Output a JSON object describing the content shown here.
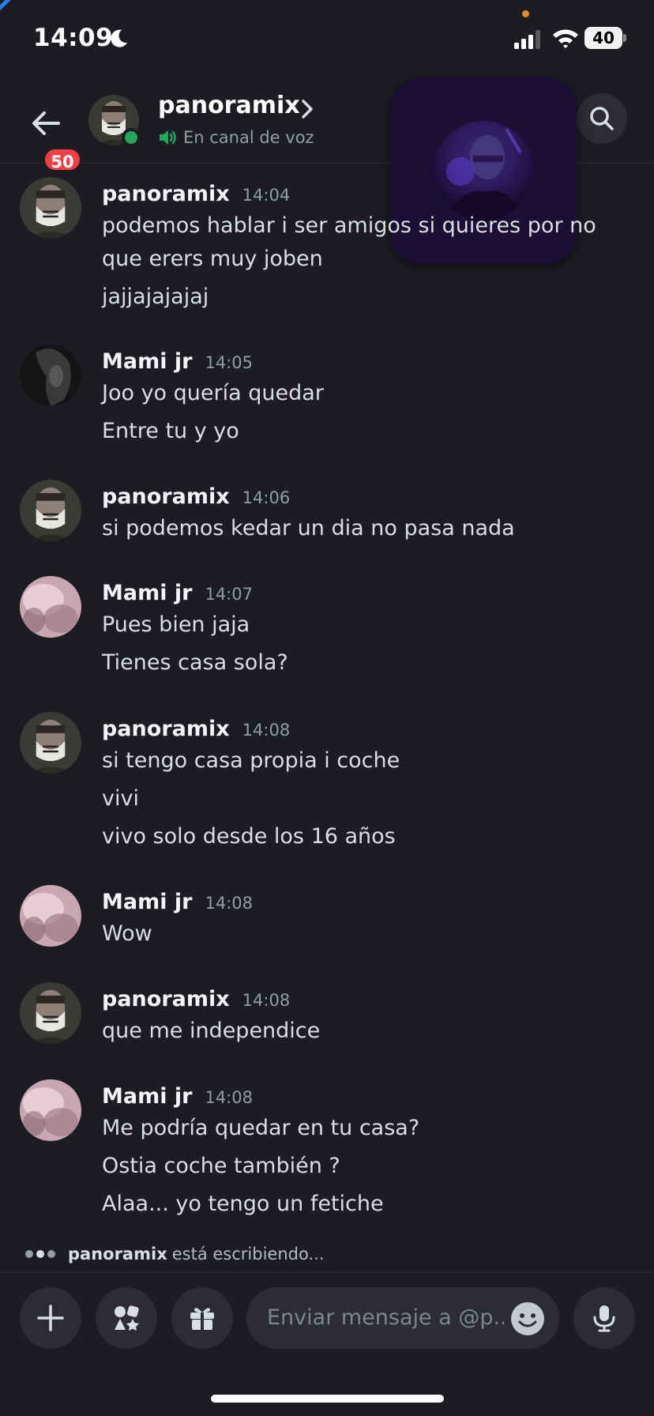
{
  "status_bar": {
    "time": "14:09",
    "battery": "40"
  },
  "header": {
    "back_badge": "50",
    "name": "panoramix",
    "status": "En canal de voz"
  },
  "messages": [
    {
      "author": "panoramix",
      "time": "14:04",
      "avatar": "skull-mask",
      "lines": [
        "podemos hablar i ser amigos si quieres por no",
        "que erers muy joben",
        "jajjajajajaj"
      ]
    },
    {
      "author": "Mami jr",
      "time": "14:05",
      "avatar": "dark-hair",
      "lines": [
        "Joo yo quería quedar",
        "Entre tu y yo"
      ]
    },
    {
      "author": "panoramix",
      "time": "14:06",
      "avatar": "skull-mask",
      "lines": [
        "si podemos kedar un dia no pasa nada"
      ]
    },
    {
      "author": "Mami jr",
      "time": "14:07",
      "avatar": "pink-blur",
      "lines": [
        "Pues bien jaja",
        "Tienes casa sola?"
      ]
    },
    {
      "author": "panoramix",
      "time": "14:08",
      "avatar": "skull-mask",
      "lines": [
        "si tengo casa propia i coche",
        "vivi",
        "vivo solo desde los 16 años"
      ]
    },
    {
      "author": "Mami jr",
      "time": "14:08",
      "avatar": "pink-blur",
      "lines": [
        "Wow"
      ]
    },
    {
      "author": "panoramix",
      "time": "14:08",
      "avatar": "skull-mask",
      "lines": [
        "que me independice"
      ]
    },
    {
      "author": "Mami jr",
      "time": "14:08",
      "avatar": "pink-blur",
      "lines": [
        "Me podría quedar en tu casa?",
        "Ostia coche también ?",
        "Alaa... yo tengo un fetiche"
      ]
    }
  ],
  "typing": {
    "name": "panoramix",
    "text": "está escribiendo..."
  },
  "composer": {
    "placeholder": "Enviar mensaje a @p.."
  },
  "colors": {
    "background": "#1c1d22",
    "badge": "#f23f43",
    "online": "#23a55a",
    "pip_bg": "#1b0f34"
  },
  "icons": [
    "moon-icon",
    "signal-icon",
    "wifi-icon",
    "back-arrow-icon",
    "chevron-right-icon",
    "speaker-icon",
    "search-icon",
    "plus-icon",
    "apps-icon",
    "gift-icon",
    "emoji-icon",
    "mic-icon"
  ]
}
